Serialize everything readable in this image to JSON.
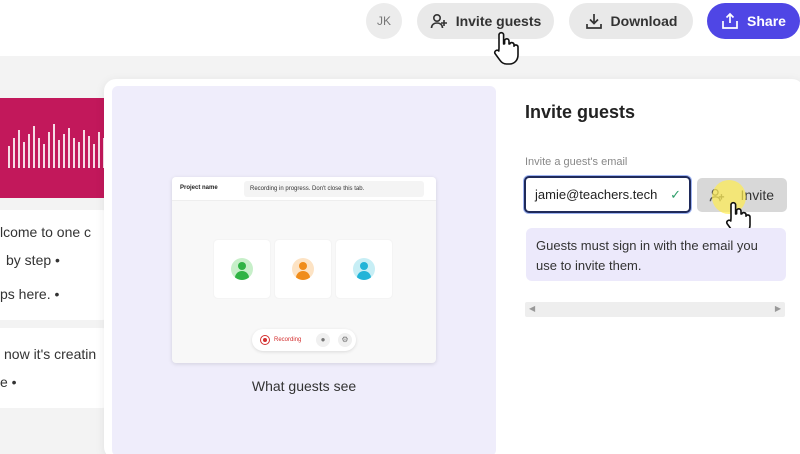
{
  "header": {
    "avatar_initials": "JK",
    "invite_label": "Invite guests",
    "download_label": "Download",
    "share_label": "Share"
  },
  "background_text": {
    "line1": "lcome to one c",
    "line2": "by step •",
    "line3": "ps here. •",
    "line4": "now it's creatin",
    "line5": "e •"
  },
  "preview": {
    "project_name": "Project name",
    "status": "Recording in progress. Don't close this tab.",
    "recording_label": "Recording",
    "caption": "What guests see"
  },
  "invite_panel": {
    "title": "Invite guests",
    "email_label": "Invite a guest's email",
    "email_value": "jamie@teachers.tech",
    "invite_button": "Invite",
    "info_text": "Guests must sign in with the email you use to invite them."
  },
  "colors": {
    "share": "#4f46e5",
    "waveform": "#c2185b",
    "preview_bg": "#efedfb",
    "info_bg": "#ece9fb"
  }
}
